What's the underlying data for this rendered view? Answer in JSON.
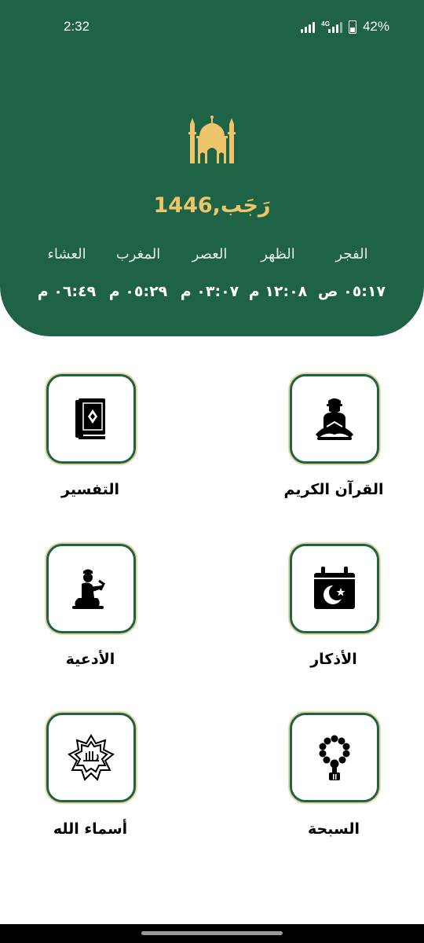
{
  "status_bar": {
    "time": "2:32",
    "network": "4G",
    "battery": "42%"
  },
  "header": {
    "hijri_date": "رَجَب,1446",
    "accent_color": "#efc56c",
    "background_color": "#1e6345"
  },
  "prayers": [
    {
      "name": "الفجر",
      "time": "٠٥:١٧ ص"
    },
    {
      "name": "الظهر",
      "time": "١٢:٠٨ م"
    },
    {
      "name": "العصر",
      "time": "٠٣:٠٧ م"
    },
    {
      "name": "المغرب",
      "time": "٠٥:٢٩ م"
    },
    {
      "name": "العشاء",
      "time": "٠٦:٤٩ م"
    }
  ],
  "menu": {
    "quran": {
      "label": "القرآن الكريم",
      "icon": "quran-reader-icon"
    },
    "tafsir": {
      "label": "التفسير",
      "icon": "book-icon"
    },
    "azkar": {
      "label": "الأذكار",
      "icon": "calendar-crescent-icon"
    },
    "duas": {
      "label": "الأدعية",
      "icon": "praying-person-icon"
    },
    "tasbih": {
      "label": "السبحة",
      "icon": "prayer-beads-icon"
    },
    "names": {
      "label": "أسماء الله",
      "icon": "allah-star-icon"
    }
  }
}
